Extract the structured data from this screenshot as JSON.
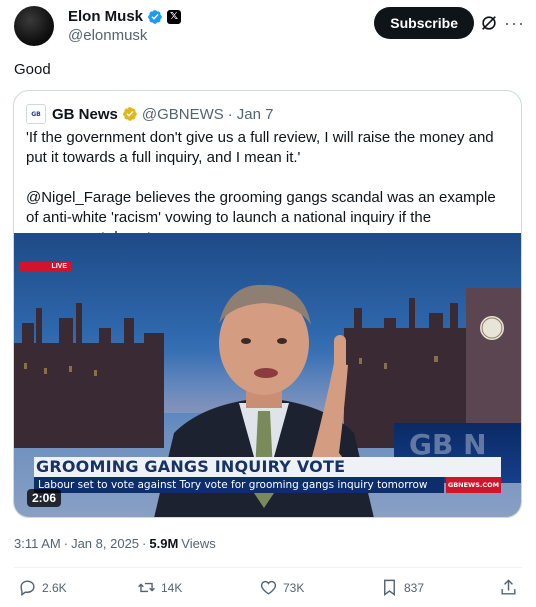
{
  "author": {
    "name": "Elon Musk",
    "handle": "@elonmusk",
    "badge_icon": "verified-badge-blue",
    "affiliate_icon": "x-logo-icon"
  },
  "header_actions": {
    "subscribe_label": "Subscribe",
    "grok_icon": "grok-icon",
    "more_icon": "more-icon"
  },
  "tweet": {
    "text": "Good"
  },
  "quoted": {
    "name": "GB News",
    "handle": "@GBNEWS",
    "separator": "·",
    "date": "Jan 7",
    "logo_text": "GB News",
    "paragraph1": "'If the government don't give us a full review, I will raise the money and put it towards a full inquiry, and I mean it.'",
    "mention": "@Nigel_Farage",
    "paragraph2_rest": " believes the grooming gangs scandal was an example of anti-white 'racism' vowing to launch a national inquiry if the government do not.",
    "video": {
      "live_label": "LIVE",
      "headline": "GROOMING GANGS INQUIRY VOTE",
      "strap": "Labour set to vote against Tory vote for grooming gangs inquiry tomorrow",
      "site": "GBNEWS.COM",
      "wall_text": "GB N",
      "duration": "2:06"
    }
  },
  "meta": {
    "time": "3:11 AM",
    "dot": "·",
    "date": "Jan 8, 2025",
    "dot2": "·",
    "views_count": "5.9M",
    "views_label": "Views"
  },
  "actions": {
    "replies": "2.6K",
    "reposts": "14K",
    "likes": "73K",
    "bookmarks": "837"
  },
  "colors": {
    "accent": "#1d9bf0",
    "gold": "#e2b719",
    "muted": "#536471",
    "live_red": "#d0142c",
    "gb_navy": "#0d2d6b"
  }
}
